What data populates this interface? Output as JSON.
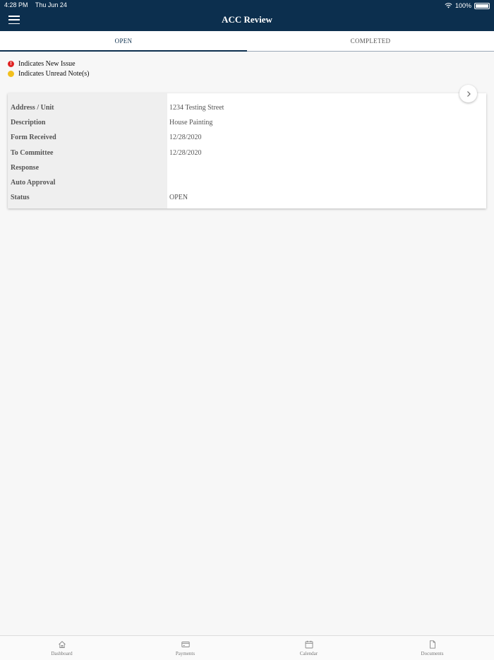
{
  "status_bar": {
    "time": "4:28 PM",
    "date": "Thu Jun 24",
    "battery": "100%"
  },
  "header": {
    "title": "ACC Review"
  },
  "tabs": [
    {
      "label": "OPEN",
      "active": true
    },
    {
      "label": "COMPLETED",
      "active": false
    }
  ],
  "legend": {
    "new_issue": "Indicates New Issue",
    "new_issue_symbol": "!",
    "unread_notes": "Indicates Unread Note(s)"
  },
  "record": {
    "fields": [
      {
        "label": "Address / Unit",
        "value": "1234 Testing Street"
      },
      {
        "label": "Description",
        "value": "House Painting"
      },
      {
        "label": "Form Received",
        "value": "12/28/2020"
      },
      {
        "label": "To Committee",
        "value": "12/28/2020"
      },
      {
        "label": "Response",
        "value": ""
      },
      {
        "label": "Auto Approval",
        "value": ""
      },
      {
        "label": "Status",
        "value": "OPEN"
      }
    ]
  },
  "bottom_nav": [
    {
      "label": "Dashboard",
      "icon": "home-icon"
    },
    {
      "label": "Payments",
      "icon": "payments-icon"
    },
    {
      "label": "Calendar",
      "icon": "calendar-icon"
    },
    {
      "label": "Documents",
      "icon": "document-icon"
    }
  ],
  "colors": {
    "header_bg": "#0c2f4e",
    "new_issue": "#e02424",
    "unread_note": "#f2c01e"
  }
}
